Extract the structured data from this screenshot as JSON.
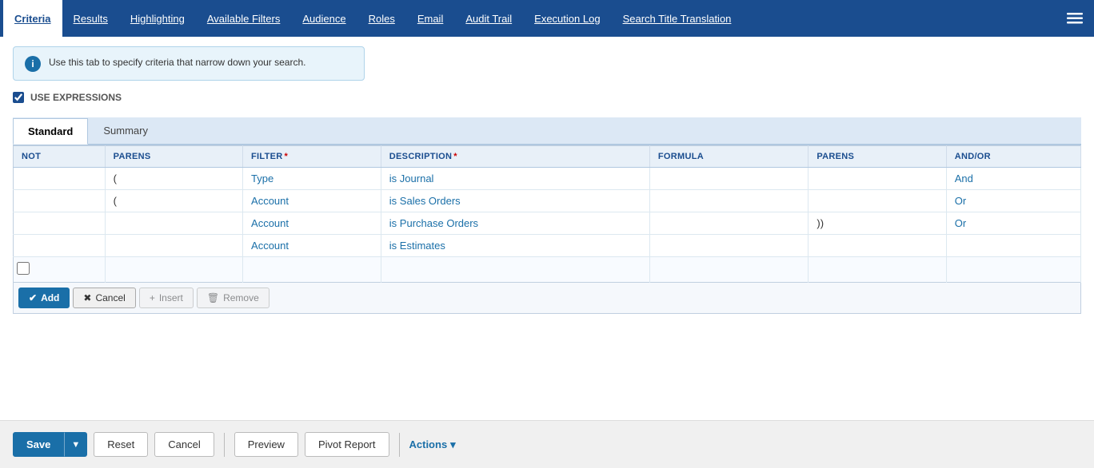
{
  "nav": {
    "items": [
      {
        "id": "criteria",
        "label": "Criteria",
        "active": true
      },
      {
        "id": "results",
        "label": "Results",
        "active": false
      },
      {
        "id": "highlighting",
        "label": "Highlighting",
        "active": false
      },
      {
        "id": "available-filters",
        "label": "Available Filters",
        "active": false
      },
      {
        "id": "audience",
        "label": "Audience",
        "active": false
      },
      {
        "id": "roles",
        "label": "Roles",
        "active": false
      },
      {
        "id": "email",
        "label": "Email",
        "active": false
      },
      {
        "id": "audit-trail",
        "label": "Audit Trail",
        "active": false
      },
      {
        "id": "execution-log",
        "label": "Execution Log",
        "active": false
      },
      {
        "id": "search-title-translation",
        "label": "Search Title Translation",
        "active": false
      }
    ]
  },
  "info": {
    "text": "Use this tab to specify criteria that narrow down your search."
  },
  "use_expressions": {
    "label": "USE EXPRESSIONS",
    "checked": true
  },
  "subtabs": [
    {
      "id": "standard",
      "label": "Standard",
      "active": true
    },
    {
      "id": "summary",
      "label": "Summary",
      "active": false
    }
  ],
  "table": {
    "headers": [
      {
        "id": "not",
        "label": "NOT",
        "required": false
      },
      {
        "id": "parens-open",
        "label": "PARENS",
        "required": false
      },
      {
        "id": "filter",
        "label": "FILTER",
        "required": true
      },
      {
        "id": "description",
        "label": "DESCRIPTION",
        "required": true
      },
      {
        "id": "formula",
        "label": "FORMULA",
        "required": false
      },
      {
        "id": "parens-close",
        "label": "PARENS",
        "required": false
      },
      {
        "id": "andor",
        "label": "AND/OR",
        "required": false
      }
    ],
    "rows": [
      {
        "not": "",
        "parens_open": "(",
        "filter": "Type",
        "description": "is Journal",
        "formula": "",
        "parens_close": "",
        "andor": "And"
      },
      {
        "not": "",
        "parens_open": "(",
        "filter": "Account",
        "description": "is Sales Orders",
        "formula": "",
        "parens_close": "",
        "andor": "Or"
      },
      {
        "not": "",
        "parens_open": "",
        "filter": "Account",
        "description": "is Purchase Orders",
        "formula": "",
        "parens_close": "))",
        "andor": "Or"
      },
      {
        "not": "",
        "parens_open": "",
        "filter": "Account",
        "description": "is Estimates",
        "formula": "",
        "parens_close": "",
        "andor": ""
      }
    ]
  },
  "action_buttons": [
    {
      "id": "add",
      "label": "Add",
      "icon": "✔",
      "type": "primary",
      "disabled": false
    },
    {
      "id": "cancel",
      "label": "Cancel",
      "icon": "✖",
      "type": "default",
      "disabled": false
    },
    {
      "id": "insert",
      "label": "Insert",
      "icon": "+",
      "type": "default",
      "disabled": true
    },
    {
      "id": "remove",
      "label": "Remove",
      "icon": "🗑",
      "type": "default",
      "disabled": true
    }
  ],
  "bottom_toolbar": {
    "save_label": "Save",
    "reset_label": "Reset",
    "cancel_label": "Cancel",
    "preview_label": "Preview",
    "pivot_report_label": "Pivot Report",
    "actions_label": "Actions"
  }
}
